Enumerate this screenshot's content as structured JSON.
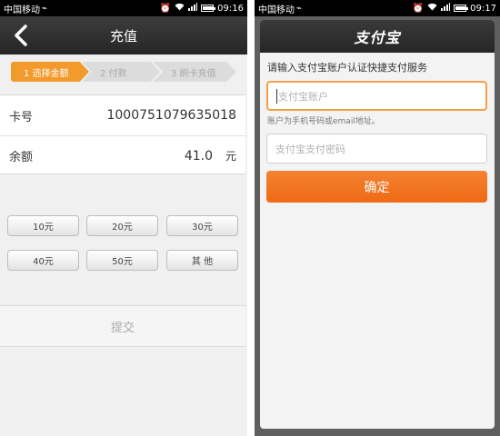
{
  "left_screen": {
    "status_bar": {
      "carrier": "中国移动",
      "time": "09:16"
    },
    "header": {
      "title": "充值"
    },
    "steps": [
      {
        "label": "1 选择金额",
        "active": true
      },
      {
        "label": "2 付款",
        "active": false
      },
      {
        "label": "3 刷卡充值",
        "active": false
      }
    ],
    "card_info": {
      "card_label": "卡号",
      "card_number": "1000751079635018",
      "balance_label": "余额",
      "balance_value": "41.0",
      "balance_unit": "元"
    },
    "amount_options": [
      "10元",
      "20元",
      "30元",
      "40元",
      "50元",
      "其 他"
    ],
    "submit_label": "提交"
  },
  "right_screen": {
    "status_bar": {
      "carrier": "中国移动",
      "time": "09:17"
    },
    "dialog": {
      "logo_text": "支付宝",
      "prompt": "请输入支付宝账户认证快捷支付服务",
      "account_placeholder": "支付宝账户",
      "account_hint": "账户为手机号码或email地址。",
      "password_placeholder": "支付宝支付密码",
      "confirm_label": "确定"
    }
  },
  "colors": {
    "accent_orange": "#f39a2c",
    "confirm_orange": "#ef6a14",
    "titlebar_dark": "#2e2e2e"
  }
}
